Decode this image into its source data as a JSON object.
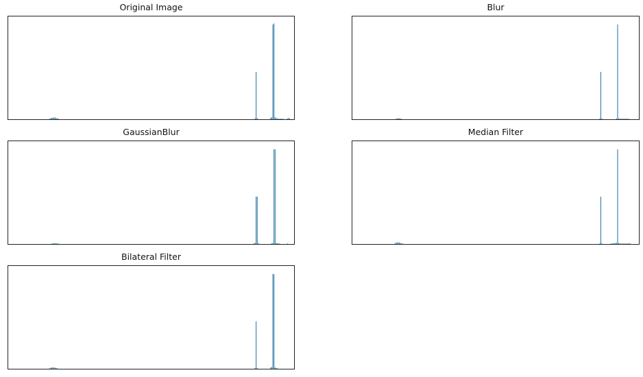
{
  "colors": {
    "bar": "#1f6f9f",
    "frame": "#222222",
    "background": "#ffffff"
  },
  "chart_data": [
    {
      "type": "bar",
      "title": "Original Image",
      "xlabel": "",
      "ylabel": "",
      "xlim": [
        0,
        256
      ],
      "ylim": [
        0,
        100
      ],
      "ticks": false,
      "grid": false,
      "x": [
        37,
        38,
        39,
        40,
        41,
        42,
        43,
        44,
        45,
        221,
        222,
        223,
        235,
        236,
        237,
        238,
        239,
        240,
        241,
        242,
        243,
        244,
        245,
        246,
        250,
        251,
        252
      ],
      "values": [
        0.6,
        1.0,
        1.4,
        1.8,
        1.5,
        1.9,
        1.2,
        1.0,
        0.6,
        1.0,
        48,
        1.2,
        1.5,
        2.0,
        96,
        97,
        2.0,
        1.2,
        0.8,
        0.6,
        0.6,
        0.6,
        0.6,
        0.6,
        0.8,
        1.4,
        0.8
      ]
    },
    {
      "type": "bar",
      "title": "Blur",
      "xlabel": "",
      "ylabel": "",
      "xlim": [
        0,
        256
      ],
      "ylim": [
        0,
        100
      ],
      "ticks": false,
      "grid": false,
      "x": [
        39,
        40,
        41,
        42,
        43,
        44,
        221,
        222,
        223,
        236,
        237,
        238,
        239,
        240,
        241,
        242,
        243,
        244,
        245,
        246,
        247
      ],
      "values": [
        0.5,
        0.9,
        1.1,
        0.9,
        0.7,
        0.5,
        0.8,
        48,
        0.8,
        0.8,
        96,
        1.0,
        0.6,
        0.6,
        0.6,
        0.6,
        0.6,
        0.6,
        0.6,
        0.6,
        0.6
      ]
    },
    {
      "type": "bar",
      "title": "GaussianBlur",
      "xlabel": "",
      "ylabel": "",
      "xlim": [
        0,
        256
      ],
      "ylim": [
        0,
        100
      ],
      "ticks": false,
      "grid": false,
      "x": [
        39,
        40,
        41,
        42,
        43,
        44,
        45,
        220,
        221,
        222,
        223,
        224,
        236,
        237,
        238,
        239,
        240,
        241,
        242,
        243,
        250
      ],
      "values": [
        0.5,
        0.8,
        0.7,
        0.6,
        0.8,
        0.6,
        0.5,
        0.8,
        1.0,
        48,
        48,
        1.0,
        0.8,
        1.0,
        96,
        96,
        1.0,
        0.8,
        0.6,
        0.5,
        0.6
      ]
    },
    {
      "type": "bar",
      "title": "Median Filter",
      "xlabel": "",
      "ylabel": "",
      "xlim": [
        0,
        256
      ],
      "ylim": [
        0,
        100
      ],
      "ticks": false,
      "grid": false,
      "x": [
        38,
        39,
        40,
        41,
        42,
        43,
        44,
        45,
        221,
        222,
        223,
        231,
        232,
        233,
        234,
        235,
        236,
        237,
        238,
        239,
        240,
        241,
        242,
        243,
        244,
        245,
        246,
        247,
        248
      ],
      "values": [
        0.6,
        1.2,
        1.8,
        1.4,
        1.7,
        1.0,
        0.8,
        0.5,
        0.6,
        48,
        0.6,
        0.5,
        0.6,
        0.6,
        0.8,
        1.0,
        1.2,
        96,
        1.0,
        0.6,
        0.5,
        0.5,
        0.5,
        0.5,
        0.5,
        0.5,
        0.5,
        0.6,
        0.8
      ]
    },
    {
      "type": "bar",
      "title": "Bilateral Filter",
      "xlabel": "",
      "ylabel": "",
      "xlim": [
        0,
        256
      ],
      "ylim": [
        0,
        100
      ],
      "ticks": false,
      "grid": false,
      "x": [
        37,
        38,
        39,
        40,
        41,
        42,
        43,
        44,
        221,
        222,
        223,
        235,
        236,
        237,
        238,
        239,
        240,
        241
      ],
      "values": [
        0.6,
        1.0,
        1.4,
        1.2,
        1.5,
        1.0,
        0.8,
        0.5,
        0.8,
        48,
        0.8,
        1.2,
        1.8,
        96,
        96,
        1.4,
        0.8,
        0.5
      ]
    }
  ]
}
